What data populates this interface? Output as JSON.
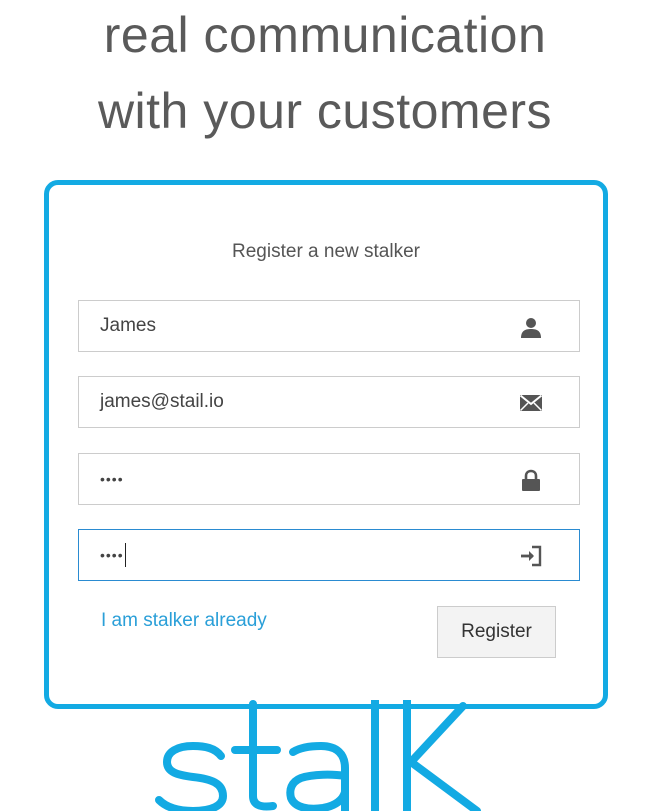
{
  "tagline": {
    "line1": "real communication",
    "line2": "with your customers"
  },
  "form": {
    "title": "Register a new stalker",
    "name_value": "James",
    "email_value": "james@stail.io",
    "password_value": "••••",
    "confirm_value": "••••",
    "login_link": "I am stalker already",
    "register_button": "Register"
  },
  "icons": {
    "name": "user-icon",
    "email": "envelope-icon",
    "password": "lock-icon",
    "confirm": "login-icon"
  },
  "colors": {
    "accent": "#13aae3",
    "link": "#2a9fd8",
    "focused_border": "#2a8bd1"
  },
  "logo_text": "stalk"
}
